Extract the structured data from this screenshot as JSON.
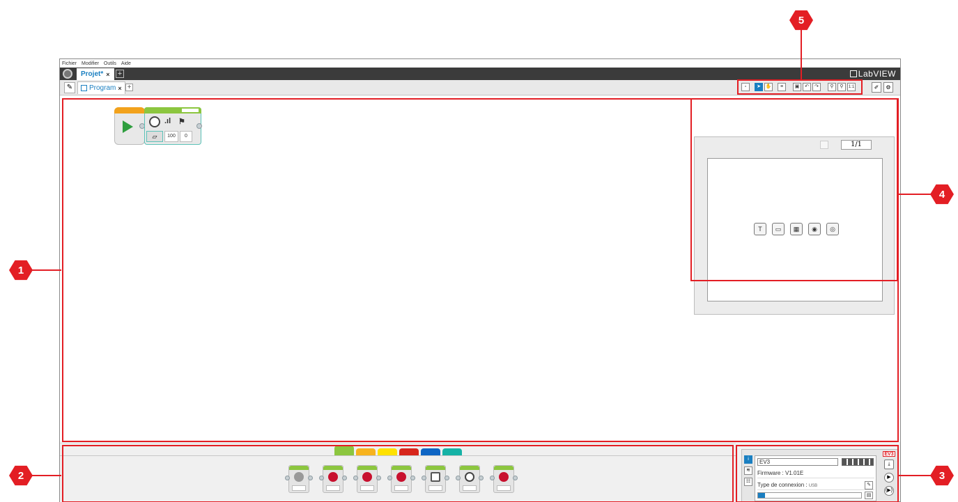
{
  "menubar": {
    "items": [
      "Fichier",
      "Modifier",
      "Outils",
      "Aide"
    ]
  },
  "project_tab": {
    "label": "Projet*",
    "close": "×",
    "add": "+"
  },
  "brand": {
    "label": "LabVIEW"
  },
  "program_tab": {
    "label": "Program",
    "close": "×",
    "add": "+"
  },
  "toolbar_icons": [
    "new-icon",
    "select-pointer-icon",
    "pan-hand-icon",
    "comment-icon",
    "save-icon",
    "undo-icon",
    "redo-icon",
    "zoom-out-icon",
    "zoom-in-icon",
    "zoom-reset-icon"
  ],
  "zoom_reset_label": "1:1",
  "side_icons": [
    "content-editor-icon",
    "variables-icon"
  ],
  "program": {
    "sound_params": [
      "100",
      "0"
    ]
  },
  "content_editor": {
    "page": "1/1",
    "icons": [
      "text-icon",
      "image-icon",
      "video-icon",
      "sound-icon",
      "sensor-icon"
    ]
  },
  "palette": {
    "tab_colors": [
      "#8cc63f",
      "#f7b31e",
      "#ffe100",
      "#d7261b",
      "#0e65c4",
      "#15b2a6"
    ],
    "block_count": 7
  },
  "hardware": {
    "brick_name": "EV3",
    "firmware": "Firmware : V1.01E",
    "connection_label": "Type de connexion :",
    "connection_type": "USB",
    "brick_label": "EV3"
  },
  "callouts": [
    "1",
    "2",
    "3",
    "4",
    "5"
  ],
  "colors": {
    "callout_red": "#e31e24",
    "accent_blue": "#1a7fc1",
    "topbar_dark": "#3b3b3b"
  }
}
